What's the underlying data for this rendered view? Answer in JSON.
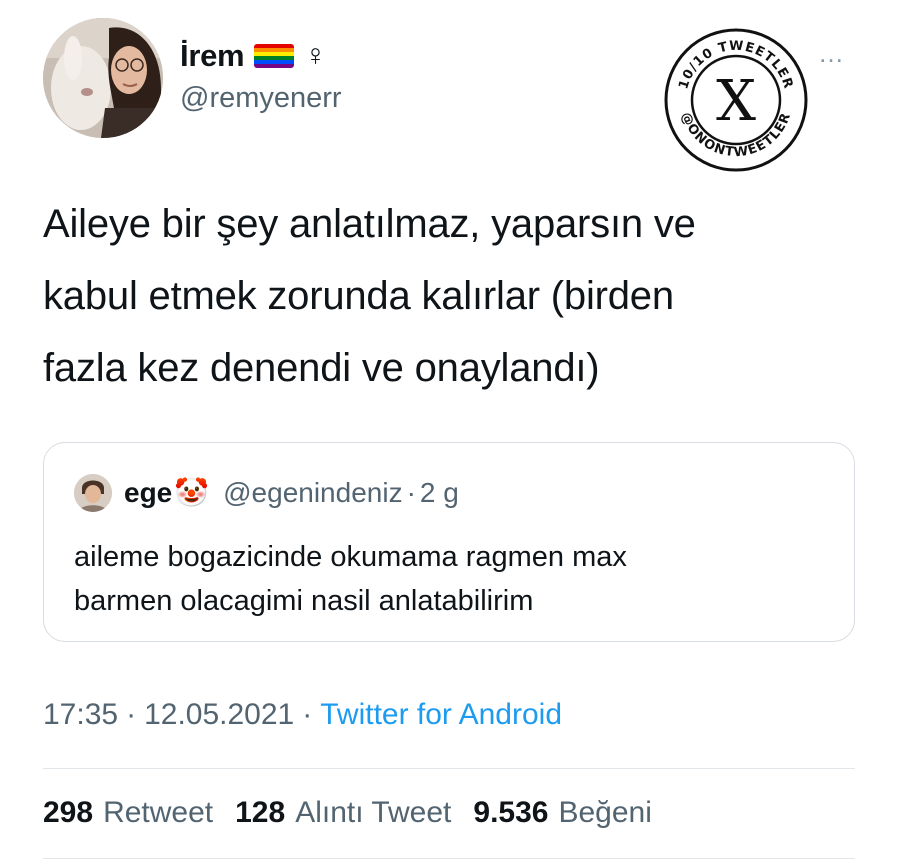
{
  "author": {
    "display_name": "İrem",
    "handle": "@remyenerr",
    "flag_emoji": "rainbow-flag",
    "symbol": "♀"
  },
  "badge": {
    "top_text": "10/10 TWEETLER",
    "bottom_text": "@ONONTWEETLER",
    "center_text": "X"
  },
  "tweet": {
    "lines": [
      "Aileye bir şey anlatılmaz, yaparsın ve",
      "kabul etmek zorunda kalırlar (birden",
      "fazla kez denendi ve onaylandı)"
    ]
  },
  "quoted": {
    "name": "ege",
    "emoji": "🤡",
    "handle": "@egenindeniz",
    "separator": "·",
    "time": "2 g",
    "lines": [
      "aileme bogazicinde okumama ragmen max",
      "barmen olacagimi nasil anlatabilirim"
    ]
  },
  "meta": {
    "time": "17:35",
    "sep1": "·",
    "date": "12.05.2021",
    "sep2": "·",
    "source": "Twitter for Android"
  },
  "stats": {
    "retweets": "298",
    "retweets_label": "Retweet",
    "quotes": "128",
    "quotes_label": "Alıntı Tweet",
    "likes": "9.536",
    "likes_label": "Beğeni"
  },
  "more_icon": "…",
  "colors": {
    "muted": "#536471",
    "link": "#1d9bf0",
    "border": "#d7dde2"
  }
}
